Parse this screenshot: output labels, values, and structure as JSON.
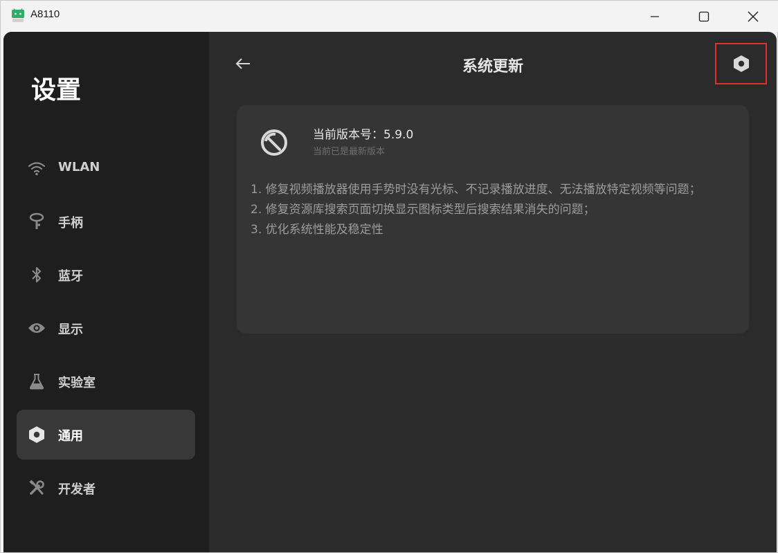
{
  "window": {
    "title": "A8110",
    "icon": "android-app-icon"
  },
  "sidebar": {
    "title": "设置",
    "items": [
      {
        "label": "WLAN",
        "icon": "wifi-icon"
      },
      {
        "label": "手柄",
        "icon": "joystick-icon"
      },
      {
        "label": "蓝牙",
        "icon": "bluetooth-icon"
      },
      {
        "label": "显示",
        "icon": "eye-icon"
      },
      {
        "label": "实验室",
        "icon": "flask-icon"
      },
      {
        "label": "通用",
        "icon": "hex-nut-icon",
        "active": true
      },
      {
        "label": "开发者",
        "icon": "tools-icon"
      }
    ]
  },
  "main": {
    "title": "系统更新",
    "card": {
      "version": "当前版本号：5.9.0",
      "status": "当前已是最新版本",
      "notes": [
        "1. 修复视频播放器使用手势时没有光标、不记录播放进度、无法播放特定视频等问题；",
        "2. 修复资源库搜索页面切换显示图标类型后搜索结果消失的问题；",
        "3. 优化系统性能及稳定性"
      ]
    }
  },
  "colors": {
    "accent_highlight": "#e03030",
    "sidebar_bg": "#1e1e1e",
    "main_bg": "#2b2b2b",
    "card_bg": "#353535"
  }
}
